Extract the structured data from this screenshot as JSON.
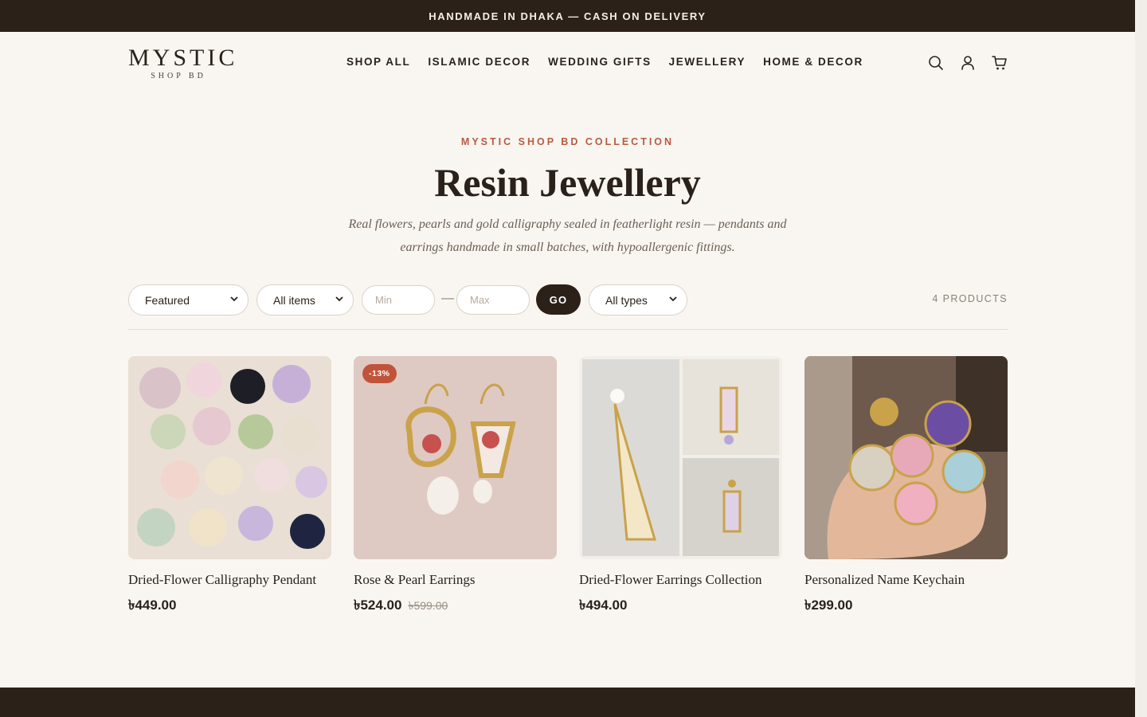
{
  "announcement": "HANDMADE IN DHAKA — CASH ON DELIVERY",
  "logo": {
    "main": "MYSTIC",
    "sub": "SHOP BD"
  },
  "nav": [
    "SHOP ALL",
    "ISLAMIC DECOR",
    "WEDDING GIFTS",
    "JEWELLERY",
    "HOME & DECOR"
  ],
  "header_icons": [
    "search-icon",
    "account-icon",
    "cart-icon"
  ],
  "hero": {
    "eyebrow": "MYSTIC SHOP BD COLLECTION",
    "title": "Resin Jewellery",
    "subtitle": "Real flowers, pearls and gold calligraphy sealed in featherlight resin — pendants and earrings handmade in small batches, with hypoallergenic fittings."
  },
  "filters": {
    "sort": "Featured",
    "category": "All items",
    "min_placeholder": "Min",
    "max_placeholder": "Max",
    "dash": "—",
    "go_label": "GO",
    "type": "All types",
    "count": "4 PRODUCTS"
  },
  "products": [
    {
      "name": "Dried-Flower Calligraphy Pendant",
      "price": "৳449.00",
      "old_price": "",
      "badge": ""
    },
    {
      "name": "Rose & Pearl Earrings",
      "price": "৳524.00",
      "old_price": "৳599.00",
      "badge": "-13%"
    },
    {
      "name": "Dried-Flower Earrings Collection",
      "price": "৳494.00",
      "old_price": "",
      "badge": ""
    },
    {
      "name": "Personalized Name Keychain",
      "price": "৳299.00",
      "old_price": "",
      "badge": ""
    }
  ],
  "colors": {
    "dark": "#2c2119",
    "accent": "#c0543b",
    "background": "#f9f6f1"
  }
}
